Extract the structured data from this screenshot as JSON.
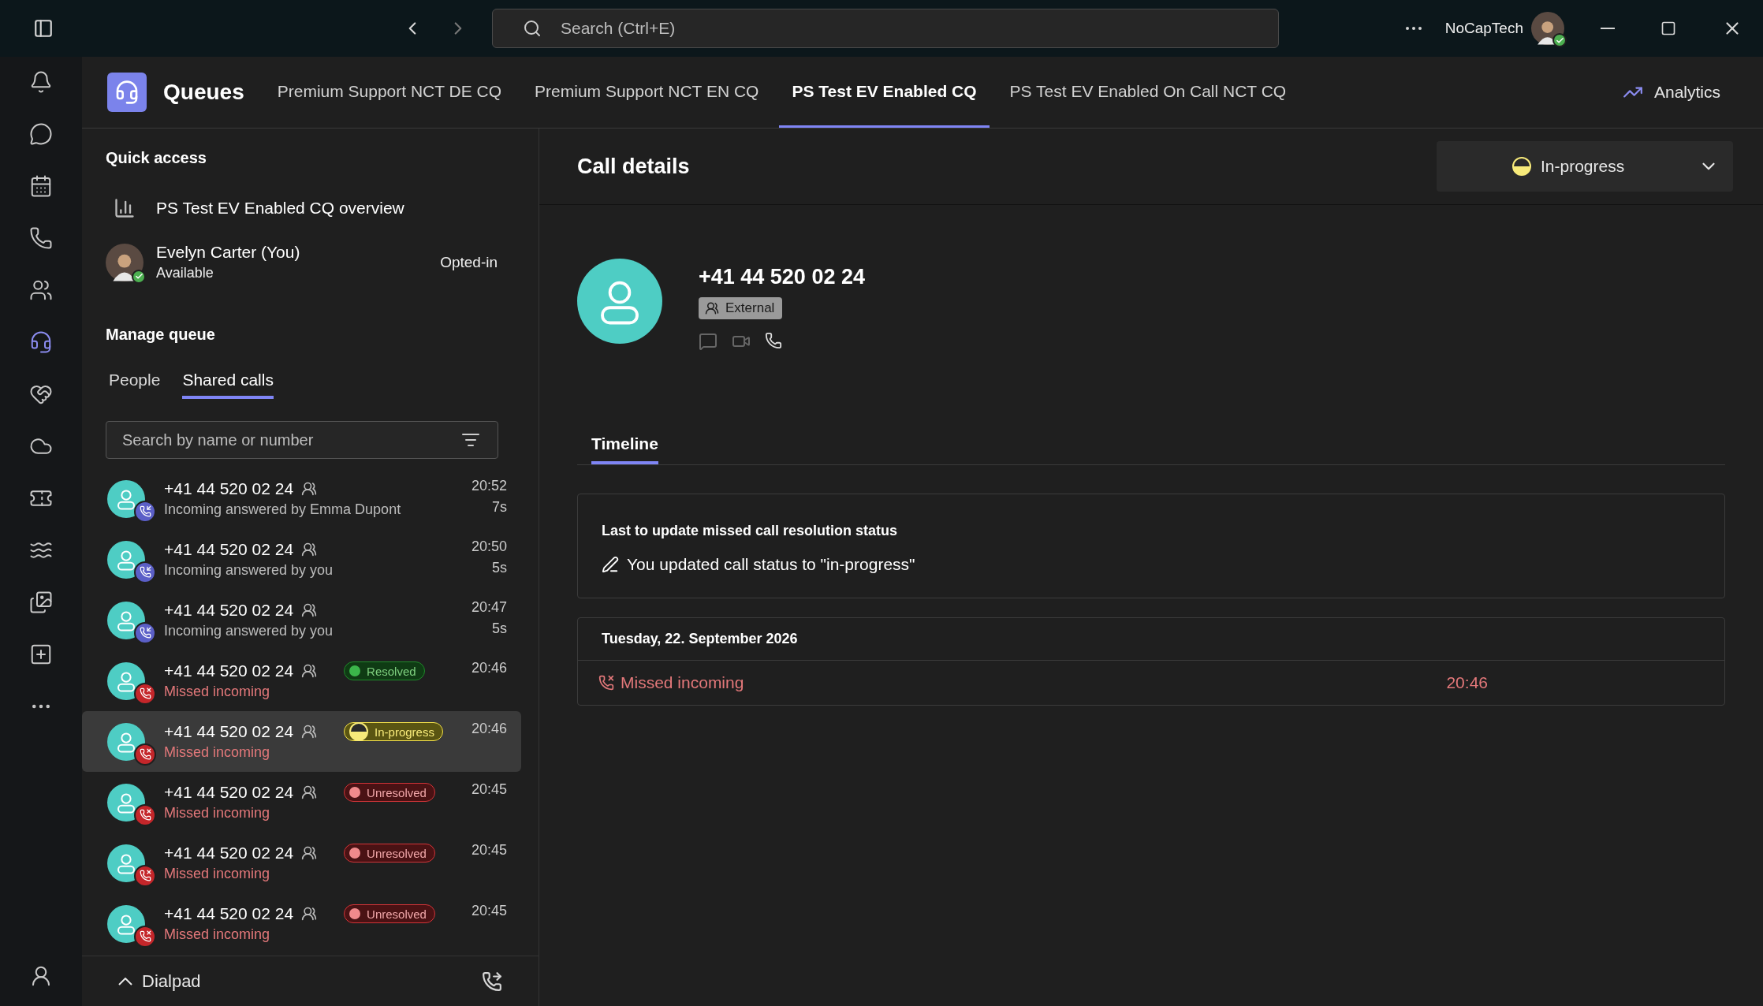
{
  "title_bar": {
    "search": {
      "placeholder": "Search (Ctrl+E)"
    },
    "account": "NoCapTech"
  },
  "rail": {
    "items": [
      {
        "kind": "bell",
        "selected": false
      },
      {
        "kind": "chat",
        "selected": false
      },
      {
        "kind": "calendar",
        "selected": false
      },
      {
        "kind": "phone",
        "selected": false
      },
      {
        "kind": "people",
        "selected": false
      },
      {
        "kind": "queues",
        "selected": true
      },
      {
        "kind": "handshake",
        "selected": false
      },
      {
        "kind": "cloud",
        "selected": false
      },
      {
        "kind": "ticket",
        "selected": false
      },
      {
        "kind": "waves",
        "selected": false
      },
      {
        "kind": "gallery",
        "selected": false
      },
      {
        "kind": "add",
        "selected": false
      },
      {
        "kind": "more",
        "selected": false
      }
    ],
    "bottom": [
      {
        "kind": "person",
        "selected": false
      }
    ]
  },
  "header": {
    "title": "Queues",
    "tabs": [
      {
        "label": "Premium Support NCT DE CQ",
        "selected": false
      },
      {
        "label": "Premium Support NCT EN CQ",
        "selected": false
      },
      {
        "label": "PS Test EV Enabled CQ",
        "selected": true
      },
      {
        "label": "PS Test EV Enabled On Call NCT CQ",
        "selected": false
      }
    ],
    "analytics": "Analytics"
  },
  "quick_access": {
    "title": "Quick access",
    "overview": "PS Test EV Enabled CQ overview",
    "agent": {
      "name": "Evelyn Carter (You)",
      "presence": "Available",
      "opt_status": "Opted-in"
    }
  },
  "manage_queue": {
    "title": "Manage queue",
    "tabs": [
      {
        "label": "People",
        "selected": false
      },
      {
        "label": "Shared calls",
        "selected": true
      }
    ],
    "search": {
      "placeholder": "Search by name or number"
    }
  },
  "calls": [
    {
      "kind": "answered",
      "number": "+41 44 520 02 24",
      "description": "Incoming answered by Emma Dupont",
      "time": "20:52",
      "duration": "7s",
      "selected": false
    },
    {
      "kind": "answered",
      "number": "+41 44 520 02 24",
      "description": "Incoming answered by you",
      "time": "20:50",
      "duration": "5s",
      "selected": false
    },
    {
      "kind": "answered",
      "number": "+41 44 520 02 24",
      "description": "Incoming answered by you",
      "time": "20:47",
      "duration": "5s",
      "selected": false
    },
    {
      "kind": "missed",
      "number": "+41 44 520 02 24",
      "description": "Missed incoming",
      "time": "20:46",
      "status": {
        "kind": "resolved",
        "label": "Resolved"
      },
      "selected": false
    },
    {
      "kind": "missed",
      "number": "+41 44 520 02 24",
      "description": "Missed incoming",
      "time": "20:46",
      "status": {
        "kind": "progress",
        "label": "In-progress"
      },
      "selected": true
    },
    {
      "kind": "missed",
      "number": "+41 44 520 02 24",
      "description": "Missed incoming",
      "time": "20:45",
      "status": {
        "kind": "unresolved",
        "label": "Unresolved"
      },
      "selected": false
    },
    {
      "kind": "missed",
      "number": "+41 44 520 02 24",
      "description": "Missed incoming",
      "time": "20:45",
      "status": {
        "kind": "unresolved",
        "label": "Unresolved"
      },
      "selected": false
    },
    {
      "kind": "missed",
      "number": "+41 44 520 02 24",
      "description": "Missed incoming",
      "time": "20:45",
      "status": {
        "kind": "unresolved",
        "label": "Unresolved"
      },
      "selected": false
    }
  ],
  "dialpad": {
    "label": "Dialpad",
    "expanded": false
  },
  "call_details": {
    "title": "Call details",
    "status": {
      "kind": "progress",
      "label": "In-progress"
    },
    "number": "+41 44 520 02 24",
    "tag": "External",
    "tabs": [
      {
        "label": "Timeline",
        "selected": true
      }
    ],
    "update_card": {
      "title": "Last to update missed call resolution status",
      "text": "You updated call status to \"in-progress\""
    },
    "day": {
      "date": "Tuesday, 22. September 2026",
      "entries": [
        {
          "kind": "missed",
          "label": "Missed incoming",
          "time": "20:46"
        }
      ]
    }
  }
}
